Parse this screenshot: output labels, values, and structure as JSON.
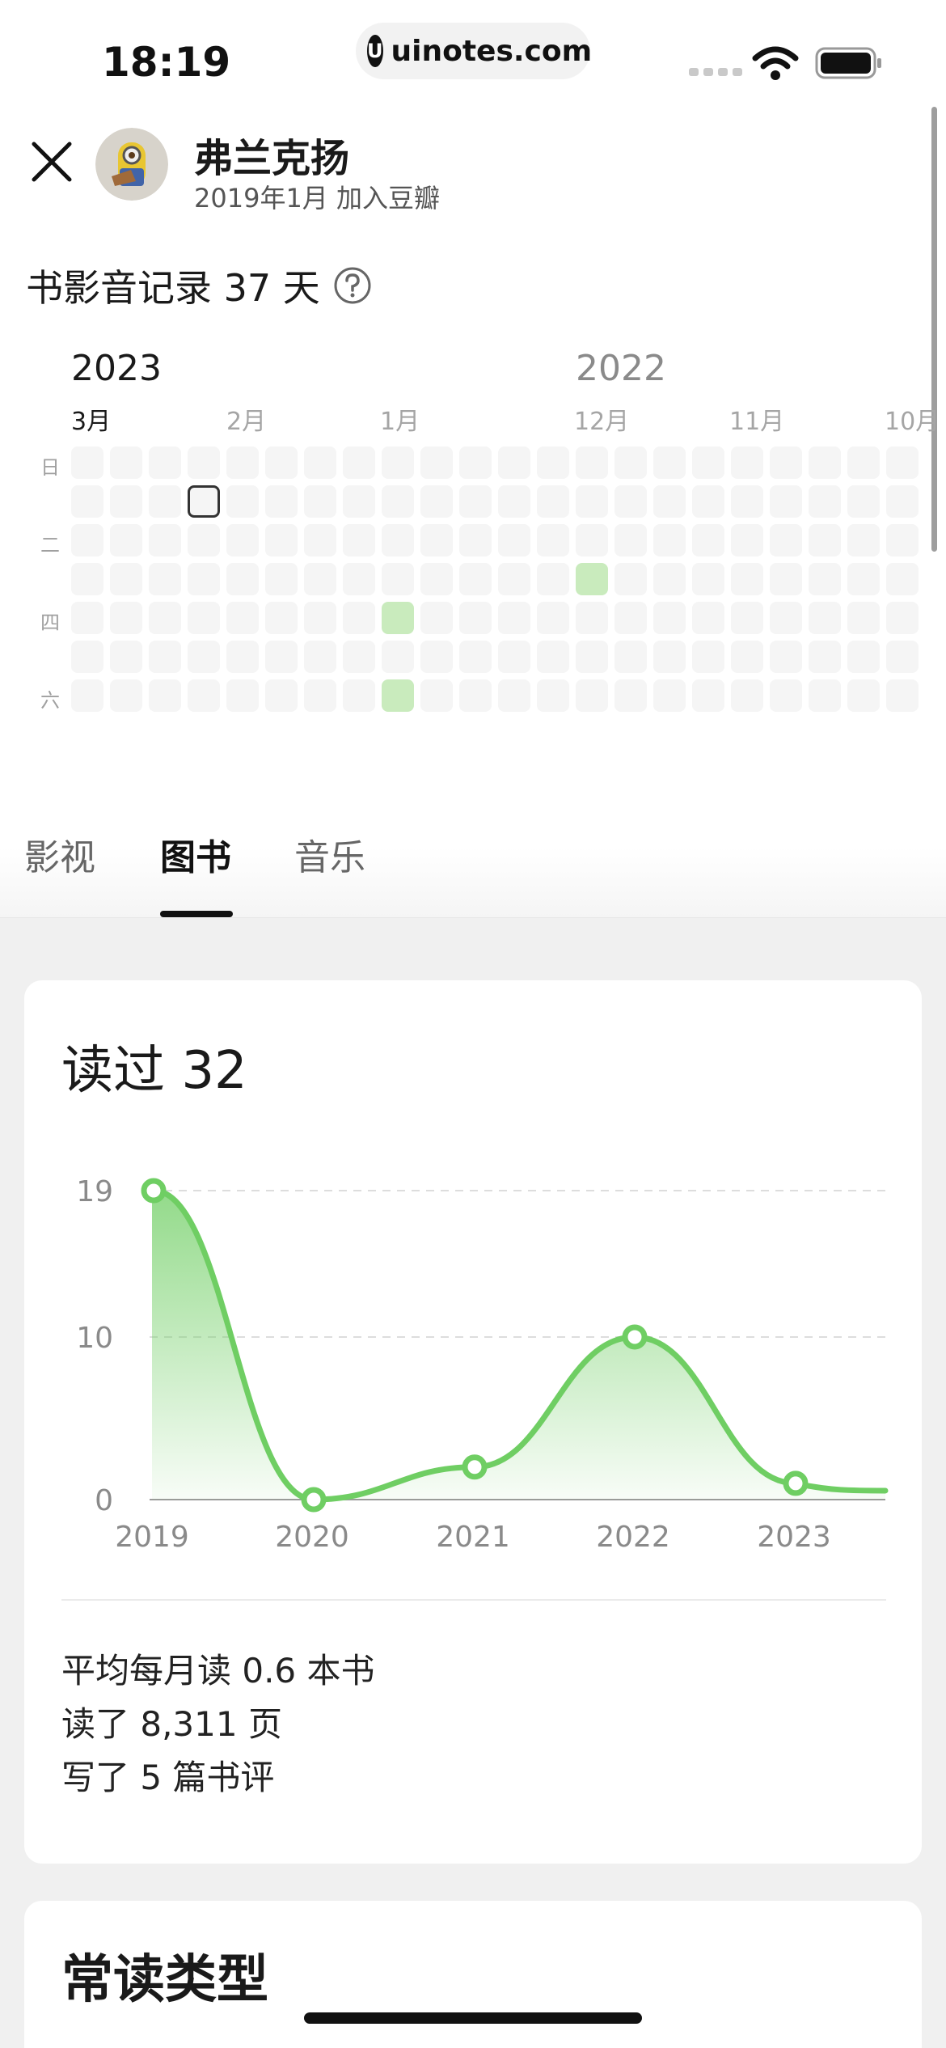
{
  "status_bar": {
    "time": "18:19",
    "url": "uinotes.com",
    "url_logo": "U"
  },
  "profile": {
    "name": "弗兰克扬",
    "joined": "2019年1月 加入豆瓣"
  },
  "record": {
    "title": "书影音记录 37 天"
  },
  "calendar": {
    "years": [
      "2023",
      "2022"
    ],
    "months": [
      "3月",
      "2月",
      "1月",
      "12月",
      "11月",
      "10月"
    ],
    "weekdays": [
      "日",
      "二",
      "四",
      "六"
    ],
    "weeks": 22,
    "days_per_week": 7,
    "active_cells": [
      {
        "week": 8,
        "day": 4
      },
      {
        "week": 8,
        "day": 6
      },
      {
        "week": 13,
        "day": 3
      }
    ],
    "today_cell": {
      "week": 3,
      "day": 1
    },
    "active_color": "#c9ebbd",
    "empty_color": "#f5f5f5"
  },
  "tabs": [
    {
      "label": "影视",
      "active": false
    },
    {
      "label": "图书",
      "active": true
    },
    {
      "label": "音乐",
      "active": false
    }
  ],
  "read_card": {
    "title": "读过 32",
    "stats": [
      "平均每月读 0.6 本书",
      "读了 8,311 页",
      "写了 5 篇书评"
    ]
  },
  "chart_data": {
    "type": "area",
    "categories": [
      "2019",
      "2020",
      "2021",
      "2022",
      "2023"
    ],
    "values": [
      19,
      0,
      2,
      10,
      1
    ],
    "y_ticks": [
      0,
      10,
      19
    ],
    "ylim": [
      0,
      19
    ],
    "grid": true,
    "color": "#6fce63"
  },
  "types_card": {
    "title": "常读类型"
  }
}
